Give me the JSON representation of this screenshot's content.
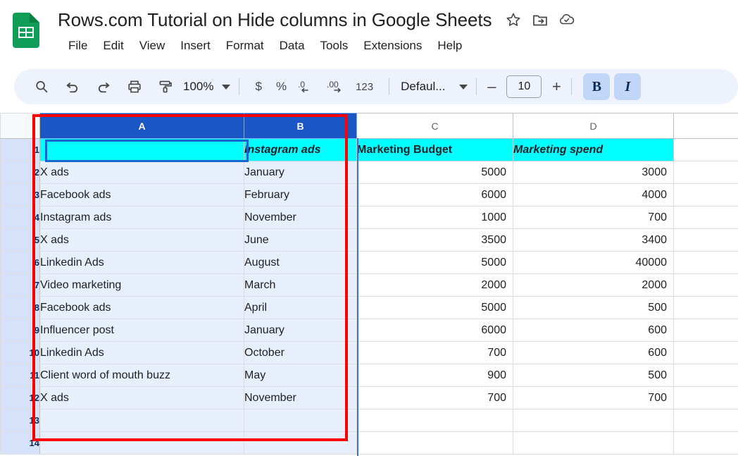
{
  "app": {
    "logo_icon": "google-sheets-logo",
    "doc_title": "Rows.com Tutorial on Hide columns in Google Sheets",
    "title_icons": [
      {
        "name": "star-icon",
        "glyph": "star"
      },
      {
        "name": "move-to-folder-icon",
        "glyph": "folder-arrow"
      },
      {
        "name": "cloud-saved-icon",
        "glyph": "cloud-check"
      }
    ],
    "menu": [
      "File",
      "Edit",
      "View",
      "Insert",
      "Format",
      "Data",
      "Tools",
      "Extensions",
      "Help"
    ]
  },
  "toolbar": {
    "search_icon": "search-icon",
    "undo_icon": "undo-icon",
    "redo_icon": "redo-icon",
    "print_icon": "print-icon",
    "paint_format_icon": "paint-format-icon",
    "zoom_value": "100%",
    "currency_label": "$",
    "percent_label": "%",
    "decrease_decimal_label": ".0",
    "increase_decimal_label": ".00",
    "more_formats_label": "123",
    "font_name": "Defaul...",
    "font_size": "10",
    "size_decrease_label": "–",
    "size_increase_label": "+",
    "bold_label": "B",
    "italic_label": "I",
    "bold_active": true,
    "italic_active": true
  },
  "sheet": {
    "column_headers": [
      "A",
      "B",
      "C",
      "D"
    ],
    "selected_columns": [
      "A",
      "B"
    ],
    "active_cell": "A1",
    "row_numbers": [
      "1",
      "2",
      "3",
      "4",
      "5",
      "6",
      "7",
      "8",
      "9",
      "10",
      "11",
      "12",
      "13",
      "14"
    ],
    "rows": [
      {
        "n": "1",
        "A": "",
        "B": "Instagram ads",
        "C": "Marketing Budget",
        "D": "Marketing spend"
      },
      {
        "n": "2",
        "A": "X ads",
        "B": "January",
        "C": "5000",
        "D": "3000"
      },
      {
        "n": "3",
        "A": "Facebook ads",
        "B": "February",
        "C": "6000",
        "D": "4000"
      },
      {
        "n": "4",
        "A": "Instagram ads",
        "B": "November",
        "C": "1000",
        "D": "700"
      },
      {
        "n": "5",
        "A": "X ads",
        "B": "June",
        "C": "3500",
        "D": "3400"
      },
      {
        "n": "6",
        "A": "Linkedin Ads",
        "B": "August",
        "C": "5000",
        "D": "40000"
      },
      {
        "n": "7",
        "A": "Video marketing",
        "B": "March",
        "C": "2000",
        "D": "2000"
      },
      {
        "n": "8",
        "A": "Facebook ads",
        "B": "April",
        "C": "5000",
        "D": "500"
      },
      {
        "n": "9",
        "A": "Influencer post",
        "B": "January",
        "C": "6000",
        "D": "600"
      },
      {
        "n": "10",
        "A": "Linkedin Ads",
        "B": "October",
        "C": "700",
        "D": "600"
      },
      {
        "n": "11",
        "A": "Client word of mouth buzz",
        "B": "May",
        "C": "900",
        "D": "500"
      },
      {
        "n": "12",
        "A": "X ads",
        "B": "November",
        "C": "700",
        "D": "700"
      },
      {
        "n": "13",
        "A": "",
        "B": "",
        "C": "",
        "D": ""
      },
      {
        "n": "14",
        "A": "",
        "B": "",
        "C": "",
        "D": ""
      }
    ]
  },
  "annotation": {
    "highlight_color": "#ff0000",
    "header_fill_color": "#00ffff",
    "selected_header_color": "#1a56c4",
    "selection_tint_color": "#e8effc"
  }
}
